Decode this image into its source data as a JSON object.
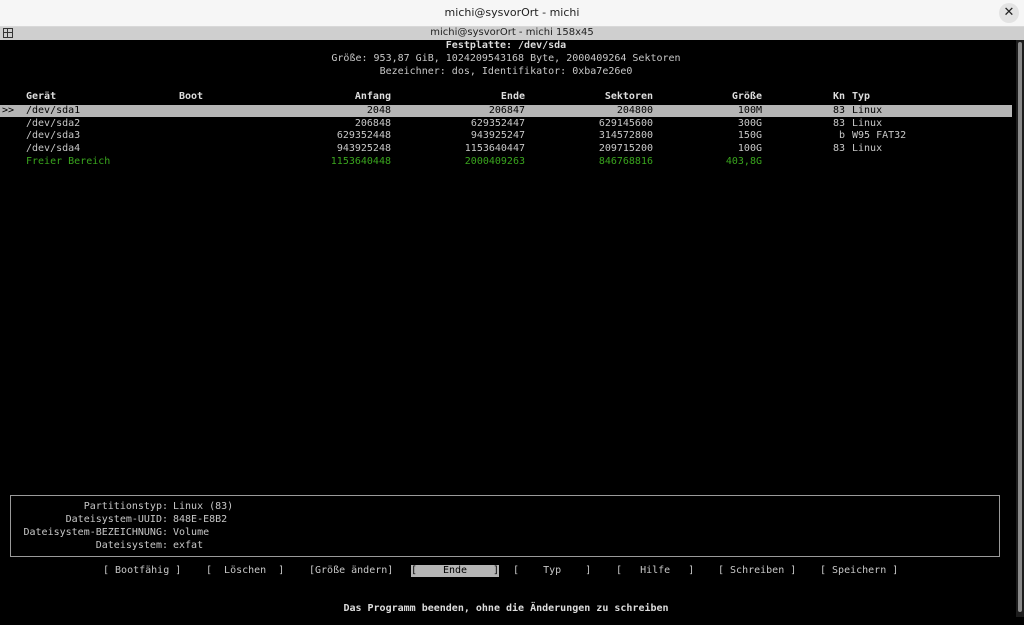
{
  "window": {
    "title": "michi@sysvorOrt - michi",
    "close_glyph": "✕"
  },
  "tab": {
    "title": "michi@sysvorOrt - michi 158x45"
  },
  "disk": {
    "heading": "Festplatte: /dev/sda",
    "size_line": "Größe: 953,87 GiB, 1024209543168 Byte, 2000409264 Sektoren",
    "label_line": "Bezeichner: dos, Identifikator: 0xba7e26e0"
  },
  "table": {
    "columns": [
      "Gerät",
      "Boot",
      "Anfang",
      "Ende",
      "Sektoren",
      "Größe",
      "Kn",
      "Typ"
    ],
    "cursor": ">>",
    "rows": [
      {
        "device": "/dev/sda1",
        "boot": "",
        "start": "2048",
        "end": "206847",
        "sectors": "204800",
        "size": "100M",
        "id": "83",
        "type": "Linux"
      },
      {
        "device": "/dev/sda2",
        "boot": "",
        "start": "206848",
        "end": "629352447",
        "sectors": "629145600",
        "size": "300G",
        "id": "83",
        "type": "Linux"
      },
      {
        "device": "/dev/sda3",
        "boot": "",
        "start": "629352448",
        "end": "943925247",
        "sectors": "314572800",
        "size": "150G",
        "id": "b",
        "type": "W95 FAT32"
      },
      {
        "device": "/dev/sda4",
        "boot": "",
        "start": "943925248",
        "end": "1153640447",
        "sectors": "209715200",
        "size": "100G",
        "id": "83",
        "type": "Linux"
      }
    ],
    "free": {
      "device": "Freier Bereich",
      "start": "1153640448",
      "end": "2000409263",
      "sectors": "846768816",
      "size": "403,8G"
    }
  },
  "info": [
    {
      "label": "Partitionstyp:",
      "value": "Linux (83)"
    },
    {
      "label": "Dateisystem-UUID:",
      "value": "848E-E8B2"
    },
    {
      "label": "Dateisystem-BEZEICHNUNG:",
      "value": "Volume"
    },
    {
      "label": "Dateisystem:",
      "value": "exfat"
    }
  ],
  "menu": {
    "bootable": "[ Bootfähig ]",
    "delete": "[  Löschen  ]",
    "resize": "[Größe ändern]",
    "quit_open": "[",
    "quit": "Ende",
    "quit_close": "]",
    "type": "[    Typ    ]",
    "help": "[   Hilfe   ]",
    "write": "[ Schreiben ]",
    "save": "[ Speichern ]"
  },
  "status": "Das Programm beenden, ohne die Änderungen zu schreiben",
  "colors": {
    "background": "#000000",
    "free_space": "#3aa61e",
    "selection": "#b5b5b5"
  }
}
